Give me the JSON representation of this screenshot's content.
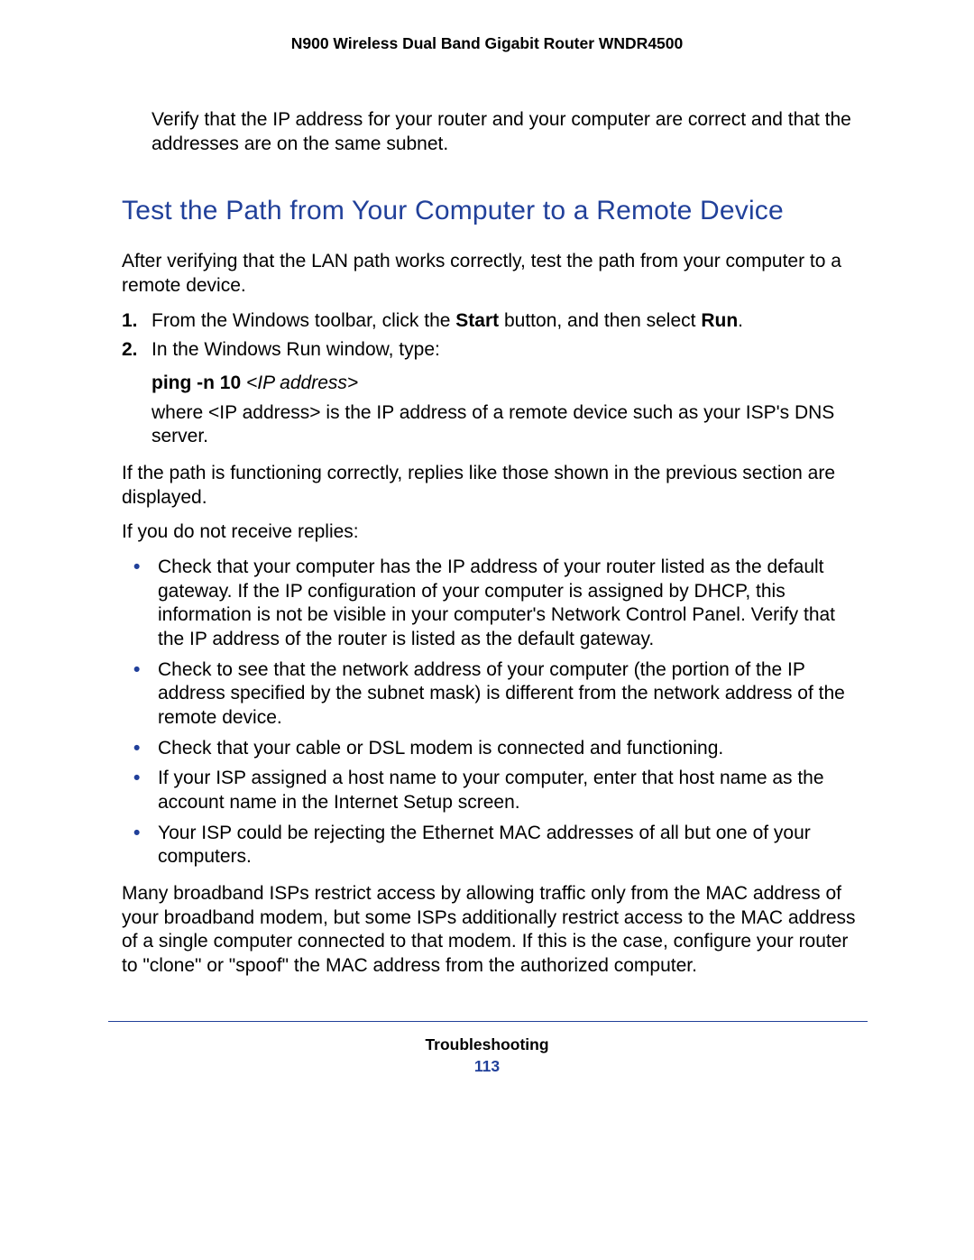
{
  "header": {
    "title": "N900 Wireless Dual Band Gigabit Router WNDR4500"
  },
  "content": {
    "intro_verify": "Verify that the IP address for your router and your computer are correct and that the addresses are on the same subnet.",
    "heading": "Test the Path from Your Computer to a Remote Device",
    "after_verify": "After verifying that the LAN path works correctly, test the path from your computer to a remote device.",
    "steps": {
      "s1_marker": "1.",
      "s1_pre": "From the Windows toolbar, click the ",
      "s1_bold1": "Start",
      "s1_mid": " button, and then select ",
      "s1_bold2": "Run",
      "s1_end": ".",
      "s2_marker": "2.",
      "s2_text": "In the Windows Run window, type:",
      "cmd_bold": "ping -n 10 ",
      "cmd_ital": "<IP address>",
      "where": "where <IP address> is the IP address of a remote device such as your ISP's DNS server."
    },
    "functioning": "If the path is functioning correctly, replies like those shown in the previous section are displayed.",
    "no_replies": "If you do not receive replies:",
    "bullets": {
      "b1": "Check that your computer has the IP address of your router listed as the default gateway. If the IP configuration of your computer is assigned by DHCP, this information is not be visible in your computer's Network Control Panel. Verify that the IP address of the router is listed as the default gateway.",
      "b2": "Check to see that the network address of your computer (the portion of the IP address specified by the subnet mask) is different from the network address of the remote device.",
      "b3": "Check that your cable or DSL modem is connected and functioning.",
      "b4": "If your ISP assigned a host name to your computer, enter that host name as the account name in the Internet Setup screen.",
      "b5": "Your ISP could be rejecting the Ethernet MAC addresses of all but one of your computers."
    },
    "closing": "Many broadband ISPs restrict access by allowing traffic only from the MAC address of your broadband modem, but some ISPs additionally restrict access to the MAC address of a single computer connected to that modem. If this is the case, configure your router to \"clone\" or \"spoof\" the MAC address from the authorized computer."
  },
  "footer": {
    "section": "Troubleshooting",
    "page": "113"
  }
}
